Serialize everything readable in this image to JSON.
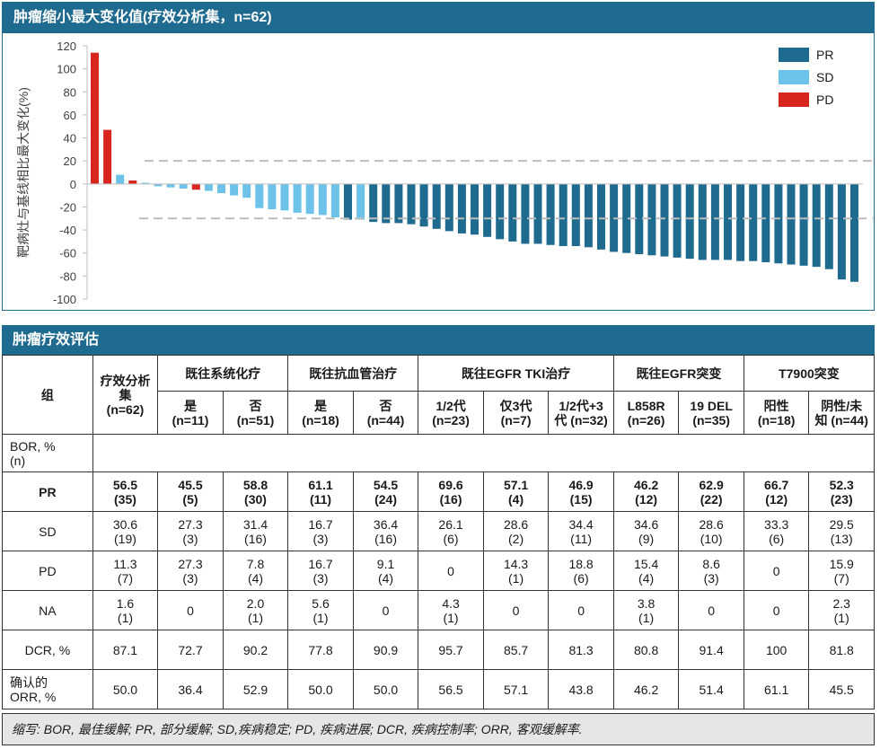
{
  "top_panel": {
    "title": "肿瘤缩小最大变化值(疗效分析集，n=62)"
  },
  "chart_data": {
    "type": "bar",
    "title": "肿瘤缩小最大变化值(疗效分析集，n=62)",
    "ylabel": "靶病灶与基线相比最大变化(%)",
    "ylim": [
      -100,
      120
    ],
    "yticks": [
      120,
      100,
      80,
      60,
      40,
      20,
      0,
      -20,
      -40,
      -60,
      -80,
      -100
    ],
    "reference_lines": [
      20,
      -30
    ],
    "legend": [
      "PR",
      "SD",
      "PD"
    ],
    "legend_position": "top-right",
    "colors": {
      "PR": "#1f6a8f",
      "SD": "#6cc2e8",
      "PD": "#d7261e"
    },
    "values": [
      114,
      47,
      8,
      3,
      1,
      -2,
      -3,
      -4,
      -5,
      -6,
      -8,
      -10,
      -12,
      -21,
      -22,
      -23,
      -25,
      -26,
      -27,
      -29,
      -31,
      -31,
      -33,
      -34,
      -34,
      -35,
      -37,
      -39,
      -41,
      -43,
      -44,
      -46,
      -48,
      -50,
      -52,
      -52,
      -53,
      -54,
      -54,
      -55,
      -57,
      -59,
      -60,
      -61,
      -62,
      -63,
      -64,
      -65,
      -66,
      -66,
      -66,
      -67,
      -67,
      -68,
      -69,
      -70,
      -71,
      -72,
      -74,
      -83,
      -85
    ],
    "response": [
      "PD",
      "PD",
      "SD",
      "PD",
      "SD",
      "SD",
      "SD",
      "SD",
      "PD",
      "SD",
      "SD",
      "SD",
      "SD",
      "SD",
      "SD",
      "SD",
      "SD",
      "SD",
      "SD",
      "SD",
      "PR",
      "SD",
      "PR",
      "PR",
      "PR",
      "PR",
      "PR",
      "PR",
      "PR",
      "PR",
      "PR",
      "PR",
      "PR",
      "PR",
      "PR",
      "PR",
      "PR",
      "PR",
      "PR",
      "PR",
      "PR",
      "PR",
      "PR",
      "PR",
      "PR",
      "PR",
      "PR",
      "PR",
      "PR",
      "PR",
      "PR",
      "PR",
      "PR",
      "PR",
      "PR",
      "PR",
      "PR",
      "PR",
      "PR",
      "PR",
      "PR"
    ]
  },
  "table": {
    "title": "肿瘤疗效评估",
    "group_label": "组",
    "col_group_efficacy": "疗效分析集",
    "col_group_efficacy_n": "(n=62)",
    "groups": [
      {
        "label": "既往系统化疗",
        "subs": [
          {
            "label": "是",
            "n": "(n=11)"
          },
          {
            "label": "否",
            "n": "(n=51)"
          }
        ]
      },
      {
        "label": "既往抗血管治疗",
        "subs": [
          {
            "label": "是",
            "n": "(n=18)"
          },
          {
            "label": "否",
            "n": "(n=44)"
          }
        ]
      },
      {
        "label": "既往EGFR TKI治疗",
        "subs": [
          {
            "label": "1/2代",
            "n": "(n=23)"
          },
          {
            "label": "仅3代",
            "n": "(n=7)"
          },
          {
            "label": "1/2代+3",
            "n": "代 (n=32)"
          }
        ]
      },
      {
        "label": "既往EGFR突变",
        "subs": [
          {
            "label": "L858R",
            "n": "(n=26)"
          },
          {
            "label": "19 DEL",
            "n": "(n=35)"
          }
        ]
      },
      {
        "label": "T7900突变",
        "subs": [
          {
            "label": "阳性",
            "n": "(n=18)"
          },
          {
            "label": "阴性/未",
            "n": "知 (n=44)"
          }
        ]
      }
    ],
    "bor_label_1": "BOR, %",
    "bor_label_2": "(n)",
    "rows": [
      {
        "label": "PR",
        "bold": true,
        "cells": [
          [
            "56.5",
            "(35)"
          ],
          [
            "45.5",
            "(5)"
          ],
          [
            "58.8",
            "(30)"
          ],
          [
            "61.1",
            "(11)"
          ],
          [
            "54.5",
            "(24)"
          ],
          [
            "69.6",
            "(16)"
          ],
          [
            "57.1",
            "(4)"
          ],
          [
            "46.9",
            "(15)"
          ],
          [
            "46.2",
            "(12)"
          ],
          [
            "62.9",
            "(22)"
          ],
          [
            "66.7",
            "(12)"
          ],
          [
            "52.3",
            "(23)"
          ]
        ]
      },
      {
        "label": "SD",
        "bold": false,
        "cells": [
          [
            "30.6",
            "(19)"
          ],
          [
            "27.3",
            "(3)"
          ],
          [
            "31.4",
            "(16)"
          ],
          [
            "16.7",
            "(3)"
          ],
          [
            "36.4",
            "(16)"
          ],
          [
            "26.1",
            "(6)"
          ],
          [
            "28.6",
            "(2)"
          ],
          [
            "34.4",
            "(11)"
          ],
          [
            "34.6",
            "(9)"
          ],
          [
            "28.6",
            "(10)"
          ],
          [
            "33.3",
            "(6)"
          ],
          [
            "29.5",
            "(13)"
          ]
        ]
      },
      {
        "label": "PD",
        "bold": false,
        "cells": [
          [
            "11.3",
            "(7)"
          ],
          [
            "27.3",
            "(3)"
          ],
          [
            "7.8",
            "(4)"
          ],
          [
            "16.7",
            "(3)"
          ],
          [
            "9.1",
            "(4)"
          ],
          [
            "0",
            ""
          ],
          [
            "14.3",
            "(1)"
          ],
          [
            "18.8",
            "(6)"
          ],
          [
            "15.4",
            "(4)"
          ],
          [
            "8.6",
            "(3)"
          ],
          [
            "0",
            ""
          ],
          [
            "15.9",
            "(7)"
          ]
        ]
      },
      {
        "label": "NA",
        "bold": false,
        "cells": [
          [
            "1.6",
            "(1)"
          ],
          [
            "0",
            ""
          ],
          [
            "2.0",
            "(1)"
          ],
          [
            "5.6",
            "(1)"
          ],
          [
            "0",
            ""
          ],
          [
            "4.3",
            "(1)"
          ],
          [
            "0",
            ""
          ],
          [
            "0",
            ""
          ],
          [
            "3.8",
            "(1)"
          ],
          [
            "0",
            ""
          ],
          [
            "0",
            ""
          ],
          [
            "2.3",
            "(1)"
          ]
        ]
      },
      {
        "label": "DCR, %",
        "bold": false,
        "cells": [
          [
            "87.1",
            ""
          ],
          [
            "72.7",
            ""
          ],
          [
            "90.2",
            ""
          ],
          [
            "77.8",
            ""
          ],
          [
            "90.9",
            ""
          ],
          [
            "95.7",
            ""
          ],
          [
            "85.7",
            ""
          ],
          [
            "81.3",
            ""
          ],
          [
            "80.8",
            ""
          ],
          [
            "91.4",
            ""
          ],
          [
            "100",
            ""
          ],
          [
            "81.8",
            ""
          ]
        ]
      },
      {
        "label": "确认的",
        "label2": "ORR, %",
        "bold": false,
        "cells": [
          [
            "50.0",
            ""
          ],
          [
            "36.4",
            ""
          ],
          [
            "52.9",
            ""
          ],
          [
            "50.0",
            ""
          ],
          [
            "50.0",
            ""
          ],
          [
            "56.5",
            ""
          ],
          [
            "57.1",
            ""
          ],
          [
            "43.8",
            ""
          ],
          [
            "46.2",
            ""
          ],
          [
            "51.4",
            ""
          ],
          [
            "61.1",
            ""
          ],
          [
            "45.5",
            ""
          ]
        ]
      }
    ],
    "footnote": "缩写: BOR, 最佳缓解; PR, 部分缓解; SD,疾病稳定; PD, 疾病进展; DCR, 疾病控制率; ORR, 客观缓解率."
  }
}
